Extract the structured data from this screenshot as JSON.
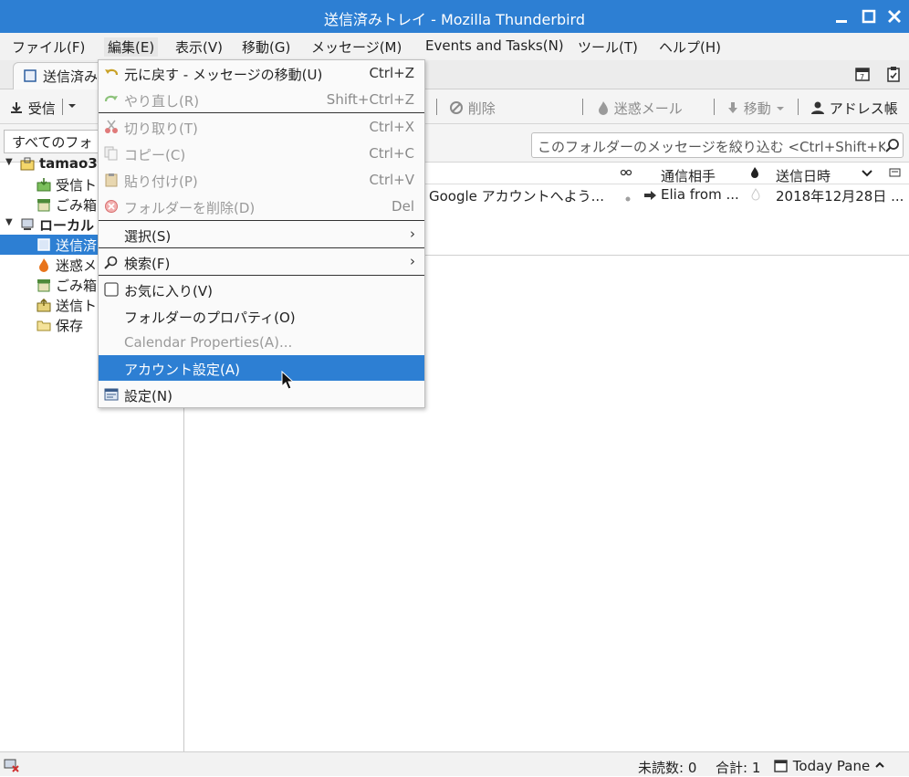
{
  "window": {
    "title": "送信済みトレイ - Mozilla Thunderbird"
  },
  "menubar": {
    "items": [
      {
        "label": "ファイル(F)"
      },
      {
        "label": "編集(E)"
      },
      {
        "label": "表示(V)"
      },
      {
        "label": "移動(G)"
      },
      {
        "label": "メッセージ(M)"
      },
      {
        "label": "Events and Tasks(N)"
      },
      {
        "label": "ツール(T)"
      },
      {
        "label": "ヘルプ(H)"
      }
    ]
  },
  "tab": {
    "label": "送信済み"
  },
  "toolbar": {
    "receive": "受信",
    "delete": "削除",
    "junk": "迷惑メール",
    "move": "移動",
    "address_book": "アドレス帳"
  },
  "folder_filter": {
    "value": "すべてのフォ"
  },
  "search": {
    "placeholder": "このフォルダーのメッセージを絞り込む <Ctrl+Shift+K"
  },
  "folders": [
    {
      "label": "tamao3s",
      "bold": true
    },
    {
      "label": "受信ト"
    },
    {
      "label": "ごみ箱"
    },
    {
      "label": "ローカル",
      "bold": true
    },
    {
      "label": "送信済"
    },
    {
      "label": "迷惑メ"
    },
    {
      "label": "ごみ箱"
    },
    {
      "label": "送信ト"
    },
    {
      "label": "保存"
    }
  ],
  "columns": {
    "correspondent": "通信相手",
    "date": "送信日時"
  },
  "message": {
    "subject": "Google アカウントへよう...",
    "from": "Elia from ...",
    "date": "2018年12月28日 ..."
  },
  "edit_menu": {
    "items": [
      {
        "label": "元に戻す - メッセージの移動(U)",
        "shortcut": "Ctrl+Z",
        "enabled": true
      },
      {
        "label": "やり直し(R)",
        "shortcut": "Shift+Ctrl+Z",
        "enabled": false
      },
      {
        "label": "切り取り(T)",
        "shortcut": "Ctrl+X",
        "enabled": false
      },
      {
        "label": "コピー(C)",
        "shortcut": "Ctrl+C",
        "enabled": false
      },
      {
        "label": "貼り付け(P)",
        "shortcut": "Ctrl+V",
        "enabled": false
      },
      {
        "label": "フォルダーを削除(D)",
        "shortcut": "Del",
        "enabled": false
      },
      {
        "label": "選択(S)",
        "enabled": true
      },
      {
        "label": "検索(F)",
        "enabled": true
      },
      {
        "label": "お気に入り(V)",
        "enabled": true
      },
      {
        "label": "フォルダーのプロパティ(O)",
        "enabled": true
      },
      {
        "label": "Calendar Properties(A)...",
        "enabled": false
      },
      {
        "label": "アカウント設定(A)",
        "enabled": true,
        "highlighted": true
      },
      {
        "label": "設定(N)",
        "enabled": true
      }
    ]
  },
  "statusbar": {
    "unread": "未読数: 0",
    "total": "合計: 1",
    "today_pane": "Today Pane"
  },
  "colors": {
    "titlebar": "#2d7fd3",
    "selection": "#2d7fd3"
  }
}
